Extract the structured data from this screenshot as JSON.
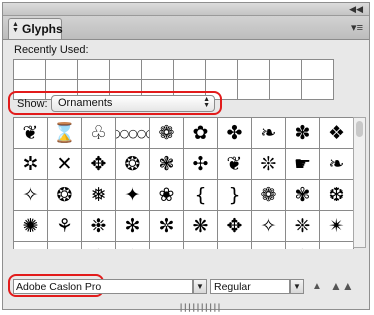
{
  "panel": {
    "tab_label": "Glyphs",
    "tab_icon": "updown-arrows-icon",
    "collapse_icon": "double-chevron-left-icon",
    "menu_icon": "panel-menu-icon"
  },
  "recently_used": {
    "label": "Recently Used:",
    "rows": 2,
    "columns": 10
  },
  "show": {
    "label": "Show:",
    "selected": "Ornaments"
  },
  "glyph_grid": {
    "columns": 10,
    "rows": [
      [
        "❦",
        "⌛",
        "♧",
        "○○○○○",
        "❁",
        "✿",
        "✤",
        "❧",
        "✽",
        "❖"
      ],
      [
        "✲",
        "✕",
        "✥",
        "❂",
        "❃",
        "✣",
        "❦",
        "❊",
        "☛",
        "❧"
      ],
      [
        "✧",
        "❂",
        "❅",
        "✦",
        "❀",
        "{",
        "}",
        "❁",
        "✾",
        "❆"
      ],
      [
        "✺",
        "⚘",
        "❉",
        "✻",
        "✼",
        "❋",
        "✥",
        "✧",
        "❈",
        "✴"
      ],
      [
        "⚜",
        "✿",
        "✽",
        "❋",
        "☞",
        "❄",
        "✠",
        "❉",
        "❁",
        "✺"
      ]
    ]
  },
  "font": {
    "family": "Adobe Caslon Pro",
    "style": "Regular"
  },
  "zoom": {
    "out_icon": "zoom-out-mountain-icon",
    "in_icon": "zoom-in-mountain-icon"
  },
  "highlight_color": "#e21b1b"
}
